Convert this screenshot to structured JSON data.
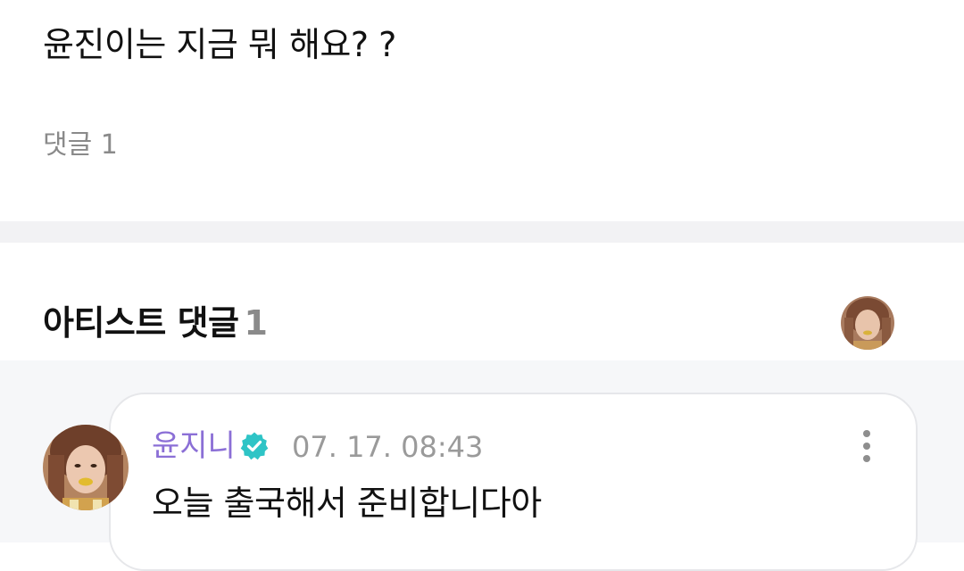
{
  "post": {
    "body": "윤진이는 지금 뭐 해요? ?",
    "comment_count_label": "댓글 1"
  },
  "artist_section": {
    "title": "아티스트 댓글",
    "count": "1",
    "header_avatar_icon": "profile-photo-avatar"
  },
  "comment": {
    "author": "윤지니",
    "verified_icon": "verified-check-badge-icon",
    "timestamp": "07. 17. 08:43",
    "text": "오늘 출국해서 준비합니다아",
    "more_icon": "vertical-ellipsis-icon"
  },
  "colors": {
    "author_purple": "#8b6fd6",
    "badge_teal": "#2ec4c6",
    "muted_gray": "#8a8a8a",
    "divider": "#f2f2f4"
  }
}
